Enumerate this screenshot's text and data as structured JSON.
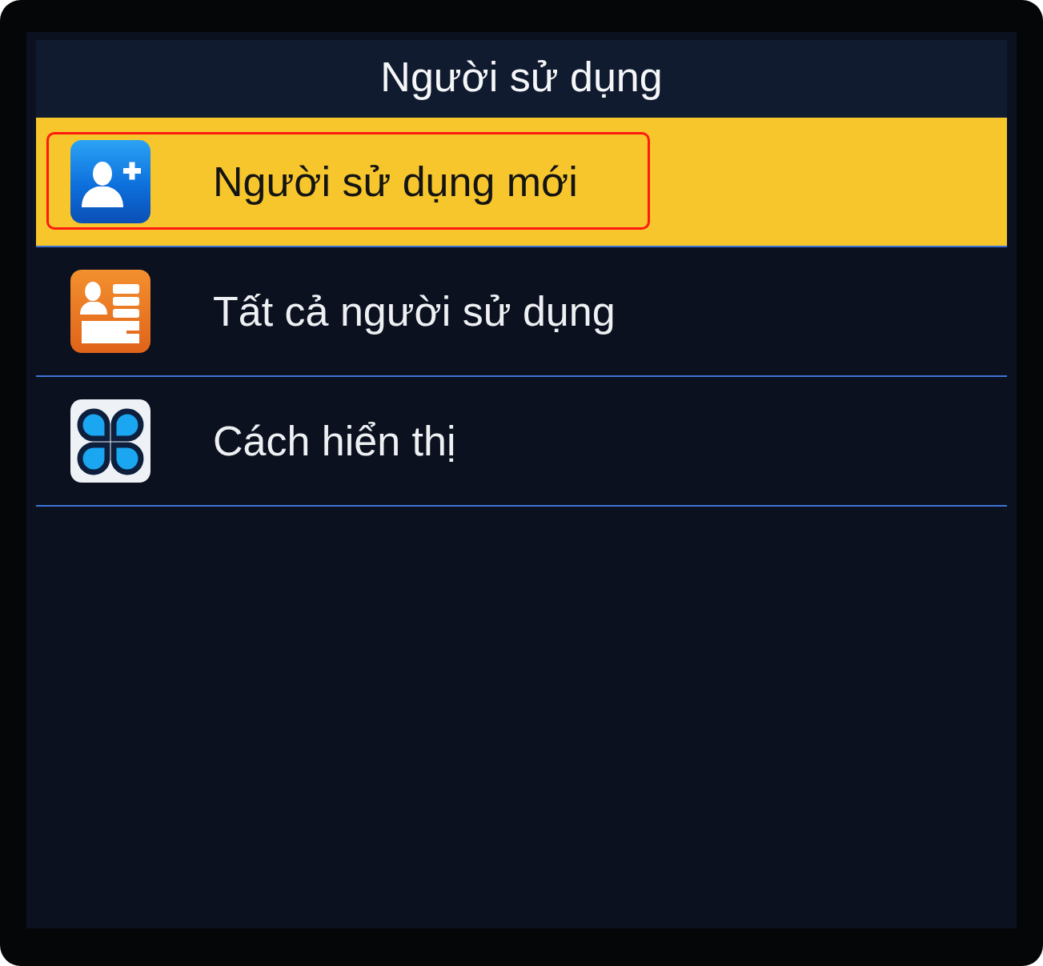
{
  "title": "Người sử dụng",
  "menu": [
    {
      "label": "Người sử dụng mới",
      "selected": true,
      "outlined": true
    },
    {
      "label": "Tất cả người sử dụng",
      "selected": false,
      "outlined": false
    },
    {
      "label": "Cách hiển thị",
      "selected": false,
      "outlined": false
    }
  ]
}
